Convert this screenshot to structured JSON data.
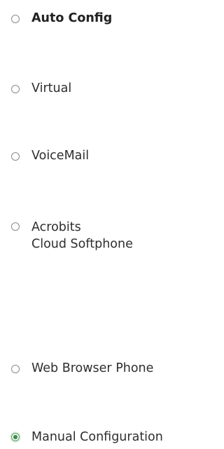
{
  "options": [
    {
      "label": "Auto Config",
      "bold": true,
      "checked": false
    },
    {
      "label": "Virtual",
      "bold": false,
      "checked": false
    },
    {
      "label": "VoiceMail",
      "bold": false,
      "checked": false
    },
    {
      "label_lines": [
        "Acrobits",
        "Cloud Softphone"
      ],
      "bold": false,
      "checked": false
    },
    {
      "label": "Web Browser Phone",
      "bold": false,
      "checked": false
    },
    {
      "label": "Manual Configuration",
      "bold": false,
      "checked": true
    }
  ],
  "colors": {
    "text": "#2e2e2e",
    "radio_border": "#8a8a8a",
    "radio_checked": "#3b8c4d",
    "radio_checked_halo": "#e3f0e5"
  }
}
